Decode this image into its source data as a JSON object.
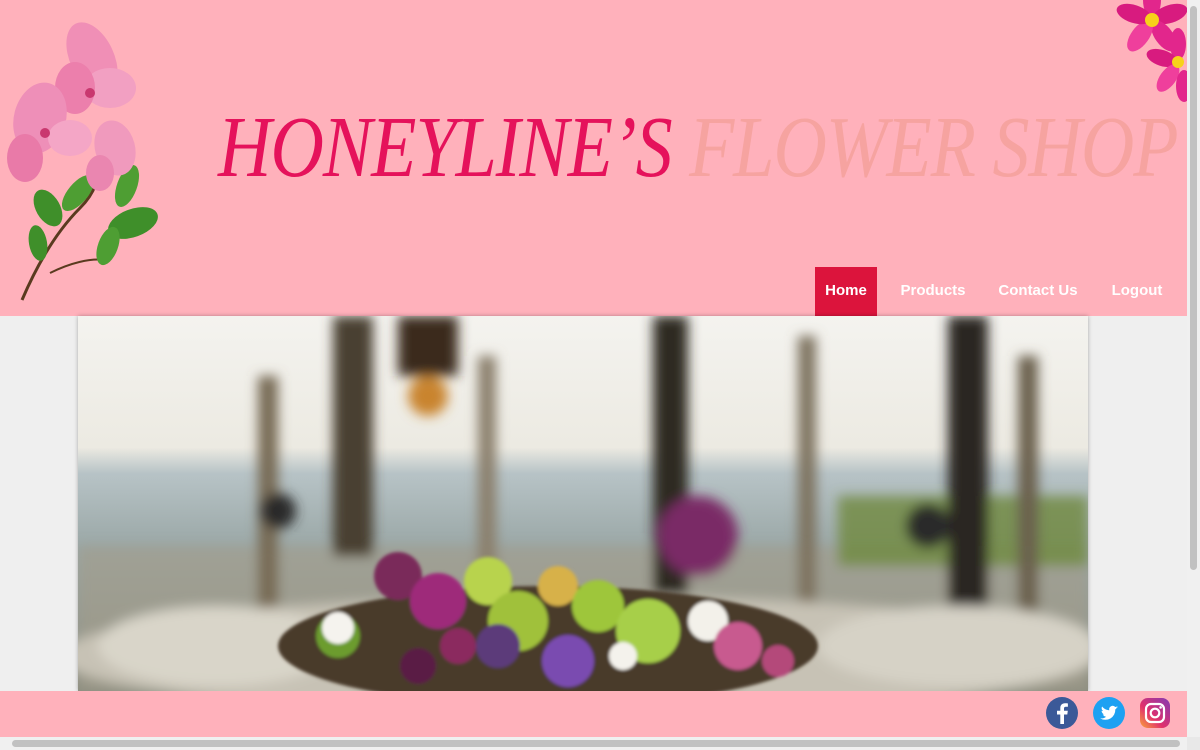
{
  "header": {
    "title_part1": "HONEYLINE’S",
    "title_part2": "FLOWER SHOP",
    "title_color_1": "#e5125b",
    "title_color_2": "#f6a3a0",
    "background": "#ffb1bb"
  },
  "nav": {
    "items": [
      {
        "label": "Home",
        "active": true
      },
      {
        "label": "Products",
        "active": false
      },
      {
        "label": "Contact Us",
        "active": false
      },
      {
        "label": "Logout",
        "active": false
      }
    ],
    "active_color": "#dc143c"
  },
  "hero": {
    "image": "blurred-outdoor-wedding-table-with-flower-centerpiece"
  },
  "footer": {
    "social_icons": [
      "facebook-icon",
      "twitter-icon",
      "instagram-icon"
    ]
  }
}
